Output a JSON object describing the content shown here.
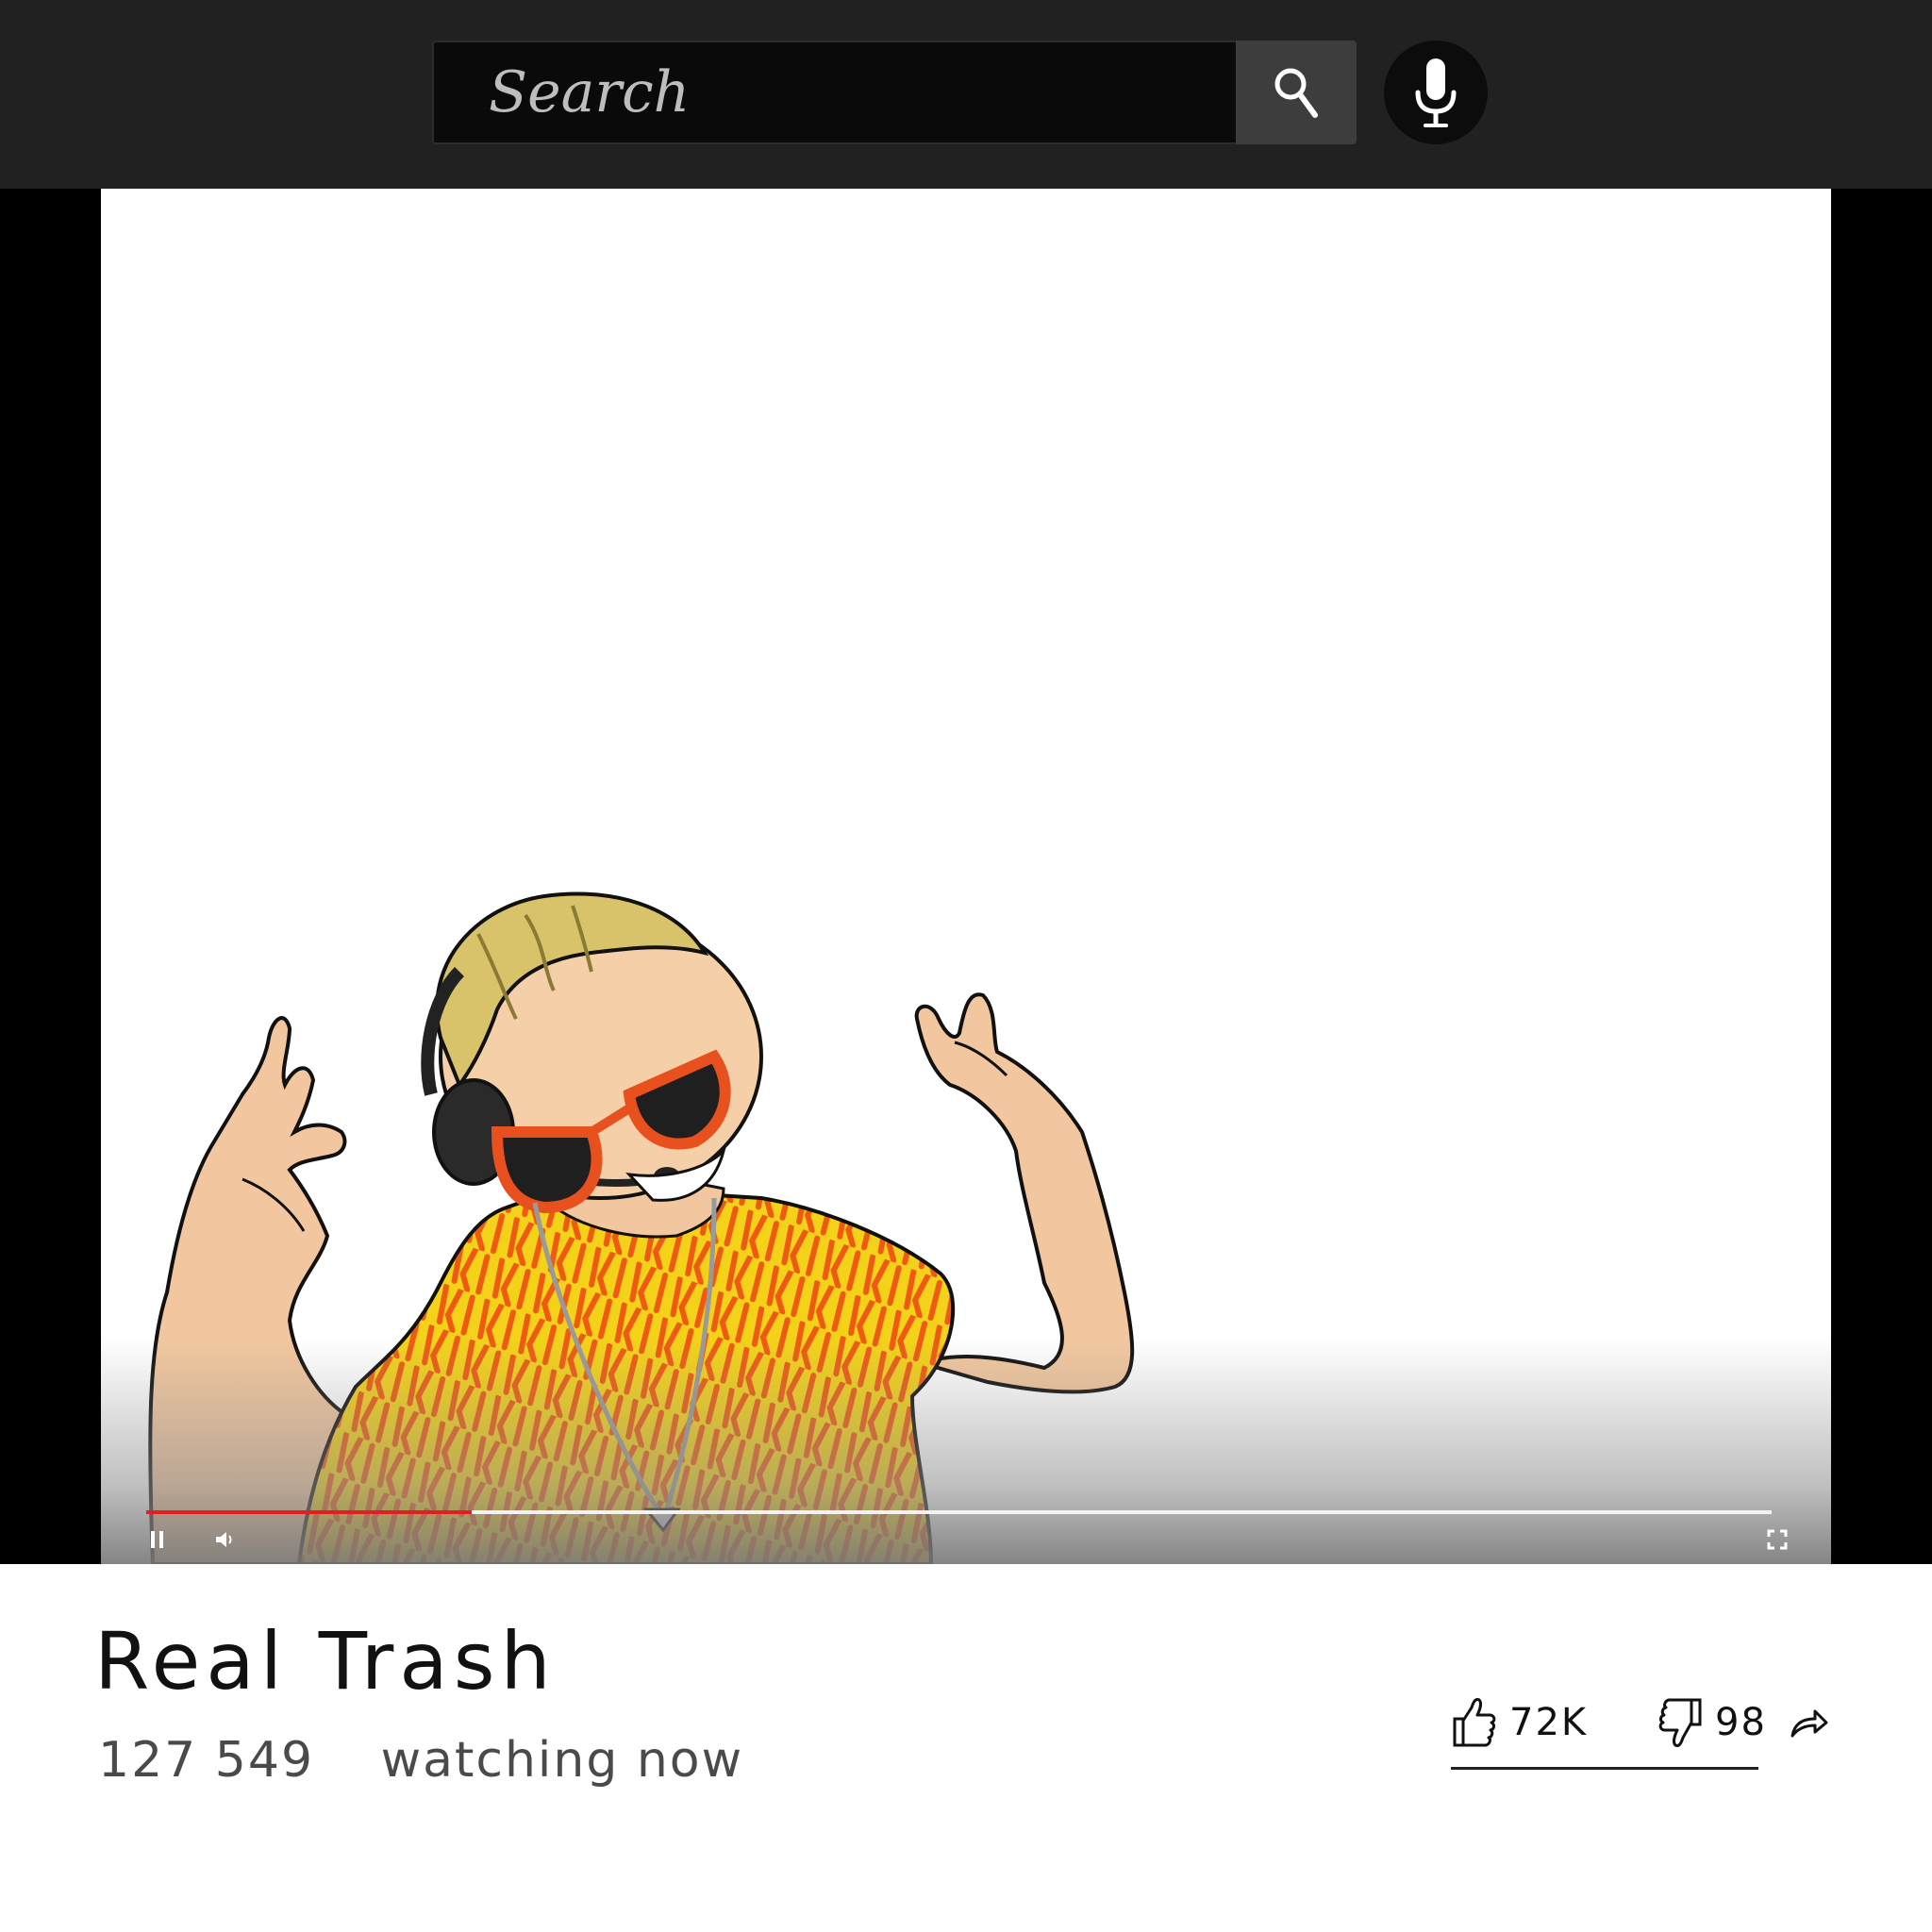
{
  "search": {
    "placeholder": "Search",
    "search_icon": "search-icon",
    "mic_icon": "mic-icon"
  },
  "player": {
    "progress": 0.2,
    "progress_color": "#e21e1e",
    "controls": {
      "pause_icon": "pause-icon",
      "volume_icon": "volume-icon",
      "fullscreen_icon": "fullscreen-icon"
    }
  },
  "video": {
    "title": "Real Trash",
    "viewer_count": "127 549",
    "viewer_label": "watching now"
  },
  "actions": {
    "likes": "72K",
    "dislikes": "98",
    "like_icon": "thumbs-up-icon",
    "dislike_icon": "thumbs-down-icon",
    "share_icon": "share-icon"
  }
}
